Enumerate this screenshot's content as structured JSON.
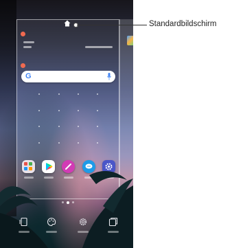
{
  "callout": {
    "label": "Standardbildschirm",
    "target": "home-screen-icon"
  },
  "colors": {
    "remove_badge": "#f06a50",
    "search_bar": "#ffffff",
    "callout_line": "#333333"
  },
  "phone": {
    "screen": "home screen edit mode",
    "widgets": [
      {
        "type": "clock-weather-widget",
        "removable": true
      },
      {
        "type": "google-search-bar",
        "removable": true,
        "logo": "G",
        "trailing_icon": "mic-icon"
      }
    ],
    "dock_apps": [
      {
        "icon": "folder-apps-icon",
        "color": "#e9e2ea"
      },
      {
        "icon": "play-store-icon",
        "color": "#ffffff"
      },
      {
        "icon": "pen-app-icon",
        "color": "#d23bb5"
      },
      {
        "icon": "messages-icon",
        "color": "#1e9be8"
      },
      {
        "icon": "settings-icon",
        "color": "#4a56c8"
      }
    ],
    "page_indicator": {
      "pages": 3,
      "current": 2
    },
    "edit_tools": [
      {
        "icon": "widgets-icon"
      },
      {
        "icon": "wallpaper-palette-icon"
      },
      {
        "icon": "settings-gear-icon"
      },
      {
        "icon": "page-layout-icon"
      }
    ]
  }
}
